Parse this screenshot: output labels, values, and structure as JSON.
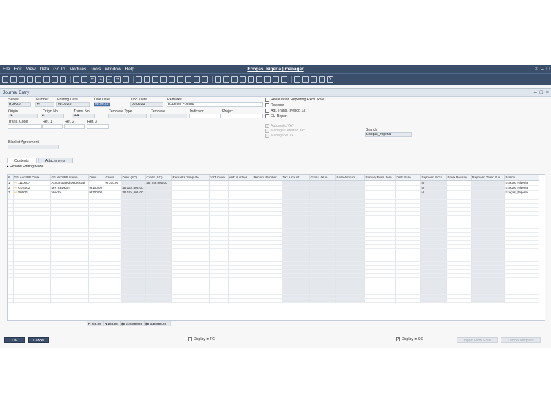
{
  "menu": [
    "File",
    "Edit",
    "View",
    "Data",
    "Go To",
    "Modules",
    "Tools",
    "Window",
    "Help"
  ],
  "window_title": "Ecogas, Nigeria | manager",
  "window_controls": [
    "⇳",
    "–",
    "□"
  ],
  "form_title": "Journal Entry",
  "form_controls": [
    "–",
    "□",
    "×"
  ],
  "header": {
    "series_label": "Series",
    "series_value": "RI2K25",
    "number_label": "Number",
    "number_value": "47",
    "posting_date_label": "Posting Date",
    "posting_date_value": "08.06.25",
    "due_date_label": "Due Date",
    "due_date_value": "08.06.25",
    "doc_date_label": "Doc. Date",
    "doc_date_value": "08.06.25",
    "remarks_label": "Remarks",
    "remarks_value": "Expense Posting",
    "origin_label": "Origin",
    "origin_value": "JE",
    "origin_no_label": "Origin No.",
    "origin_no_value": "47",
    "trans_no_label": "Trans. No.",
    "trans_no_value": "344",
    "template_type_label": "Template Type",
    "template_label": "Template",
    "indicator_label": "Indicator",
    "project_label": "Project",
    "trans_code_label": "Trans. Code",
    "ref1_label": "Ref. 1",
    "ref2_label": "Ref. 2",
    "ref3_label": "Ref. 3",
    "blanket_label": "Blanket Agreement",
    "branch_label": "Branch",
    "branch_value": "Ecogas_Nigeria"
  },
  "checkboxes": {
    "revaluation": "Revaluation Reporting Exch. Rate",
    "reverse": "Reverse",
    "adj_trans": "Adj. Trans. (Period 13)",
    "eu_report": "EU Report",
    "automatic_vat": "Automatic VAT",
    "manage_deferred_tax": "Manage Deferred Tax",
    "manage_wtax": "Manage WTax"
  },
  "tabs": [
    "Contents",
    "Attachments"
  ],
  "expand_label": "Expand Editing Mode",
  "columns": [
    "#",
    "G/L Acct/BP Code",
    "G/L Acct/BP Name",
    "Debit",
    "Credit",
    "Debit (SC)",
    "Credit (SC)",
    "Remarks Template",
    "VAT Code",
    "VAT Number",
    "Receipt Number",
    "Tax Amount",
    "Gross Value",
    "Base Amount",
    "Primary Form Item",
    "Distr. Rule",
    "Payment Block",
    "Block Reason",
    "Payment Order Run",
    "Branch"
  ],
  "rows": [
    {
      "num": "1",
      "code": "1110007",
      "name": "Accumulated Depreciati",
      "debit": "",
      "credit": "₦ 200.00",
      "debit_sc": "",
      "credit_sc": "$D 249,000.00",
      "payment_block": "N",
      "branch": "Ecogas_Nigeria"
    },
    {
      "num": "2",
      "code": "CUS002",
      "name": "Mrs SEDKAT",
      "debit": "₦ 100.00",
      "credit": "",
      "debit_sc": "$D 124,500.00",
      "credit_sc": "",
      "payment_block": "N",
      "branch": "Ecogas_Nigeria"
    },
    {
      "num": "3",
      "code": "V00001",
      "name": "Vendor",
      "debit": "₦ 100.00",
      "credit": "",
      "debit_sc": "$D 124,500.00",
      "credit_sc": "",
      "payment_block": "N",
      "branch": "Ecogas_Nigeria"
    }
  ],
  "totals": {
    "debit": "₦ 200.00",
    "credit": "₦ 200.00",
    "debit_sc": "$D 249,000.00",
    "credit_sc": "$D 249,000.00"
  },
  "footer": {
    "ok": "OK",
    "cancel": "Cancel",
    "display_fc": "Display in FC",
    "display_sc": "Display in SC",
    "import_excel": "Import From Excel",
    "cancel_template": "Cancel Template"
  }
}
